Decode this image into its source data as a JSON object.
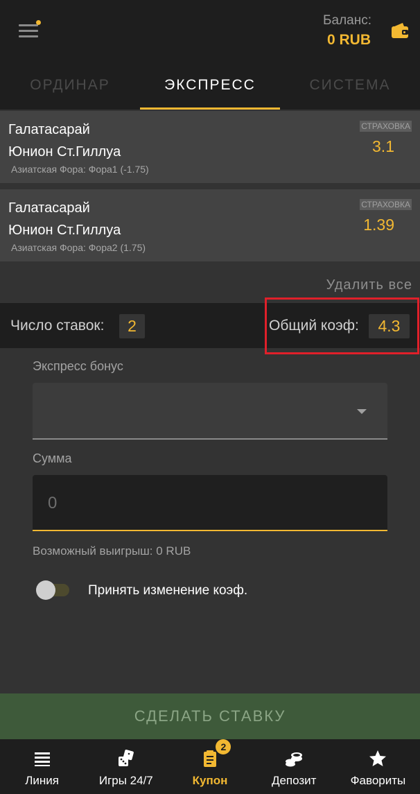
{
  "header": {
    "balance_label": "Баланс:",
    "balance_value": "0 RUB"
  },
  "tabs": [
    {
      "label": "ОРДИНАР",
      "active": false
    },
    {
      "label": "ЭКСПРЕСС",
      "active": true
    },
    {
      "label": "СИСТЕМА",
      "active": false
    }
  ],
  "bets": [
    {
      "team1": "Галатасарай",
      "team2": "Юнион Ст.Гиллуа",
      "market": "Азиатская Фора: Фора1 (-1.75)",
      "insurance": "СТРАХОВКА",
      "coef": "3.1"
    },
    {
      "team1": "Галатасарай",
      "team2": "Юнион Ст.Гиллуа",
      "market": "Азиатская Фора: Фора2 (1.75)",
      "insurance": "СТРАХОВКА",
      "coef": "1.39"
    }
  ],
  "delete_all": "Удалить все",
  "summary": {
    "count_label": "Число ставок:",
    "count_value": "2",
    "total_label": "Общий коэф:",
    "total_value": "4.3"
  },
  "form": {
    "bonus_label": "Экспресс бонус",
    "bonus_value": "",
    "amount_label": "Сумма",
    "amount_value": "0",
    "possible_win": "Возможный выигрыш: 0 RUB",
    "accept_changes_label": "Принять изменение коэф.",
    "accept_changes_on": false
  },
  "place_bet_label": "СДЕЛАТЬ СТАВКУ",
  "nav": [
    {
      "label": "Линия",
      "icon": "list-icon",
      "active": false
    },
    {
      "label": "Игры 24/7",
      "icon": "dice-icon",
      "active": false
    },
    {
      "label": "Купон",
      "icon": "coupon-icon",
      "active": true,
      "badge": "2"
    },
    {
      "label": "Депозит",
      "icon": "coins-icon",
      "active": false
    },
    {
      "label": "Фавориты",
      "icon": "star-icon",
      "active": false
    }
  ],
  "colors": {
    "accent": "#f2b832",
    "background": "#333333",
    "header": "#1e1e1e",
    "highlight_box": "#e0202a",
    "place_bet": "#3e5a3a"
  }
}
